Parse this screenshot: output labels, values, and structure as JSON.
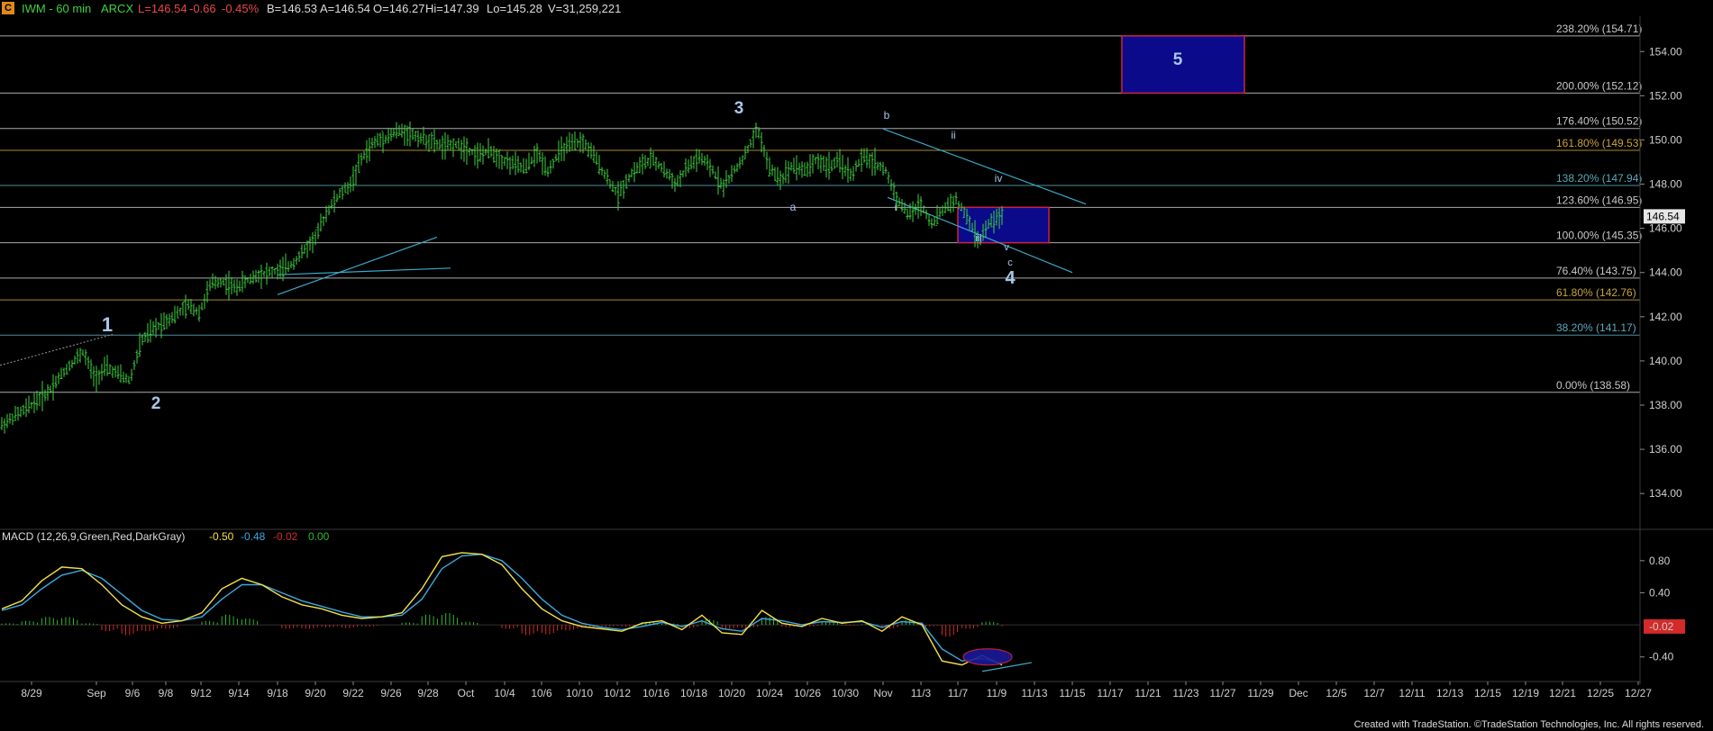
{
  "header": {
    "symbol_icon": "C",
    "symbol": "IWM - 60 min",
    "exchange": "ARCX",
    "last": "L=146.54",
    "change": "-0.66",
    "change_pct": "-0.45%",
    "bid": "B=146.53",
    "ask": "A=146.54",
    "open": "O=146.27",
    "high": "Hi=147.39",
    "low": "Lo=145.28",
    "volume": "V=31,259,221"
  },
  "macd_header": {
    "label": "MACD (12,26,9,Green,Red,DarkGray)",
    "v1": "-0.50",
    "v2": "-0.48",
    "v3": "-0.02",
    "v4": "0.00"
  },
  "colors": {
    "background": "#000000",
    "bar": "#3fd13f",
    "fib_line": "#c8c8c8",
    "fib_618": "#c8a23c",
    "target_box": "#0a0a8a",
    "target_border": "#cc2244",
    "channel": "#3aa9c9",
    "macd_line": "#f2e04a",
    "signal_line": "#3aa9e0",
    "hist_pos": "#2fb82f",
    "hist_neg": "#d42a2a",
    "wave_label": "#a9c7e8",
    "last_price_tag": "#e6e6e6"
  },
  "chart_data": {
    "type": "candlestick",
    "title": "IWM - 60 min ARCX",
    "y_ticks": [
      134.0,
      136.0,
      138.0,
      140.0,
      142.0,
      144.0,
      146.0,
      148.0,
      150.0,
      152.0,
      154.0
    ],
    "y_tick_labels": [
      "134.00",
      "136.00",
      "138.00",
      "140.00",
      "142.00",
      "144.00",
      "146.00",
      "148.00",
      "150.00",
      "152.00",
      "154.00"
    ],
    "ylim": [
      132.5,
      155.6
    ],
    "x_tick_labels": [
      "8/29",
      "Sep",
      "9/6",
      "9/8",
      "9/12",
      "9/14",
      "9/18",
      "9/20",
      "9/22",
      "9/26",
      "9/28",
      "Oct",
      "10/4",
      "10/6",
      "10/10",
      "10/12",
      "10/16",
      "10/18",
      "10/20",
      "10/24",
      "10/26",
      "10/30",
      "Nov",
      "11/3",
      "11/7",
      "11/9",
      "11/13",
      "11/15",
      "11/17",
      "11/21",
      "11/23",
      "11/27",
      "11/29",
      "Dec",
      "12/5",
      "12/7",
      "12/11",
      "12/13",
      "12/15",
      "12/19",
      "12/21",
      "12/25",
      "12/27"
    ],
    "last_price": 146.54,
    "last_price_label": "146.54",
    "price_path": [
      [
        0,
        137.1
      ],
      [
        2,
        137.8
      ],
      [
        4,
        138.6
      ],
      [
        5,
        139.3
      ],
      [
        6,
        139.9
      ],
      [
        7,
        140.4
      ],
      [
        8,
        139.2
      ],
      [
        9,
        139.7
      ],
      [
        10,
        139.4
      ],
      [
        11,
        139.1
      ],
      [
        12,
        140.9
      ],
      [
        13,
        141.4
      ],
      [
        14,
        141.8
      ],
      [
        15,
        142.1
      ],
      [
        16,
        142.5
      ],
      [
        17,
        142.2
      ],
      [
        18,
        143.5
      ],
      [
        19,
        143.6
      ],
      [
        20,
        143.3
      ],
      [
        22,
        143.9
      ],
      [
        24,
        144.1
      ],
      [
        25,
        144.4
      ],
      [
        26,
        145.0
      ],
      [
        27,
        145.6
      ],
      [
        28,
        146.8
      ],
      [
        29,
        147.5
      ],
      [
        30,
        148.0
      ],
      [
        31,
        149.2
      ],
      [
        32,
        149.9
      ],
      [
        33,
        150.1
      ],
      [
        34,
        150.4
      ],
      [
        35,
        150.3
      ],
      [
        36,
        150.1
      ],
      [
        37,
        149.9
      ],
      [
        38,
        149.7
      ],
      [
        39,
        149.8
      ],
      [
        40,
        149.6
      ],
      [
        41,
        149.3
      ],
      [
        42,
        149.5
      ],
      [
        43,
        149.1
      ],
      [
        44,
        148.9
      ],
      [
        45,
        148.7
      ],
      [
        46,
        149.4
      ],
      [
        47,
        148.6
      ],
      [
        48,
        149.5
      ],
      [
        49,
        149.8
      ],
      [
        50,
        149.9
      ],
      [
        51,
        149.2
      ],
      [
        52,
        148.3
      ],
      [
        53,
        147.5
      ],
      [
        54,
        148.4
      ],
      [
        55,
        148.9
      ],
      [
        56,
        149.1
      ],
      [
        57,
        148.6
      ],
      [
        58,
        148.0
      ],
      [
        59,
        148.8
      ],
      [
        60,
        149.2
      ],
      [
        61,
        148.7
      ],
      [
        62,
        147.9
      ],
      [
        63,
        148.6
      ],
      [
        64,
        149.4
      ],
      [
        65,
        150.5
      ],
      [
        66,
        148.7
      ],
      [
        67,
        148.2
      ],
      [
        68,
        148.9
      ],
      [
        69,
        148.6
      ],
      [
        70,
        149.1
      ],
      [
        71,
        148.8
      ],
      [
        72,
        149.0
      ],
      [
        73,
        148.4
      ],
      [
        74,
        149.2
      ],
      [
        75,
        149.0
      ],
      [
        76,
        148.6
      ],
      [
        77,
        147.3
      ],
      [
        78,
        146.6
      ],
      [
        79,
        147.1
      ],
      [
        80,
        146.2
      ],
      [
        81,
        146.9
      ],
      [
        82,
        147.3
      ],
      [
        83,
        146.5
      ],
      [
        84,
        145.4
      ],
      [
        85,
        146.3
      ],
      [
        86,
        146.54
      ]
    ],
    "fib_levels": [
      {
        "label": "238.20% (154.71)",
        "value": 154.71
      },
      {
        "label": "200.00% (152.12)",
        "value": 152.12
      },
      {
        "label": "176.40% (150.52)",
        "value": 150.52
      },
      {
        "label": "161.80% (149.53)",
        "value": 149.53
      },
      {
        "label": "138.20% (147.94)",
        "value": 147.94
      },
      {
        "label": "123.60% (146.95)",
        "value": 146.95
      },
      {
        "label": "100.00% (145.35)",
        "value": 145.35
      },
      {
        "label": "76.40% (143.75)",
        "value": 143.75
      },
      {
        "label": "61.80% (142.76)",
        "value": 142.76
      },
      {
        "label": "38.20% (141.17)",
        "value": 141.17
      },
      {
        "label": "0.00% (138.58)",
        "value": 138.58
      }
    ],
    "wave_labels": [
      {
        "text": "1",
        "size": "large"
      },
      {
        "text": "2",
        "size": "large"
      },
      {
        "text": "3",
        "size": "large"
      },
      {
        "text": "a",
        "size": "small"
      },
      {
        "text": "b",
        "size": "small"
      },
      {
        "text": "i",
        "size": "small"
      },
      {
        "text": "ii",
        "size": "small"
      },
      {
        "text": "iii",
        "size": "small"
      },
      {
        "text": "iv",
        "size": "small"
      },
      {
        "text": "v",
        "size": "small"
      },
      {
        "text": "c",
        "size": "small"
      },
      {
        "text": "4",
        "size": "large"
      },
      {
        "text": "5",
        "size": "large"
      }
    ],
    "macd": {
      "y_ticks": [
        0.8,
        0.4,
        -0.02,
        -0.4
      ],
      "y_tick_labels": [
        "0.80",
        "0.40",
        "-0.02",
        "-0.40"
      ],
      "ylim": [
        -0.65,
        1.0
      ],
      "macd_line": [
        0.2,
        0.3,
        0.55,
        0.72,
        0.7,
        0.5,
        0.25,
        0.1,
        0.02,
        0.05,
        0.15,
        0.45,
        0.58,
        0.5,
        0.35,
        0.25,
        0.2,
        0.12,
        0.08,
        0.1,
        0.15,
        0.45,
        0.85,
        0.9,
        0.88,
        0.75,
        0.45,
        0.2,
        0.05,
        -0.02,
        -0.05,
        -0.08,
        0.02,
        0.05,
        -0.06,
        0.12,
        -0.1,
        -0.12,
        0.18,
        0.02,
        -0.02,
        0.08,
        0.02,
        0.05,
        -0.08,
        0.1,
        0.0,
        -0.45,
        -0.5,
        -0.38,
        -0.5
      ],
      "signal_line": [
        0.18,
        0.25,
        0.45,
        0.62,
        0.68,
        0.58,
        0.38,
        0.18,
        0.07,
        0.05,
        0.1,
        0.32,
        0.5,
        0.5,
        0.4,
        0.3,
        0.23,
        0.16,
        0.1,
        0.1,
        0.12,
        0.32,
        0.7,
        0.86,
        0.88,
        0.8,
        0.58,
        0.32,
        0.12,
        0.02,
        -0.03,
        -0.06,
        -0.02,
        0.03,
        -0.02,
        0.05,
        -0.05,
        -0.08,
        0.08,
        0.05,
        0.0,
        0.04,
        0.03,
        0.04,
        -0.03,
        0.04,
        0.02,
        -0.3,
        -0.45,
        -0.42,
        -0.48
      ],
      "histogram": [
        0.02,
        0.05,
        0.1,
        0.1,
        0.02,
        -0.08,
        -0.13,
        -0.08,
        -0.05,
        0.0,
        0.05,
        0.13,
        0.08,
        0.0,
        -0.05,
        -0.05,
        -0.03,
        -0.04,
        -0.02,
        0.0,
        0.03,
        0.13,
        0.15,
        0.04,
        0.0,
        -0.05,
        -0.13,
        -0.12,
        -0.07,
        -0.04,
        -0.02,
        -0.02,
        0.04,
        0.02,
        -0.04,
        0.07,
        -0.05,
        -0.04,
        0.1,
        -0.03,
        -0.02,
        0.04,
        -0.01,
        0.01,
        -0.05,
        0.06,
        -0.02,
        -0.15,
        -0.05,
        0.04,
        -0.02
      ]
    }
  },
  "footer": {
    "credit": "Created with TradeStation. ©TradeStation Technologies, Inc. All rights reserved."
  }
}
